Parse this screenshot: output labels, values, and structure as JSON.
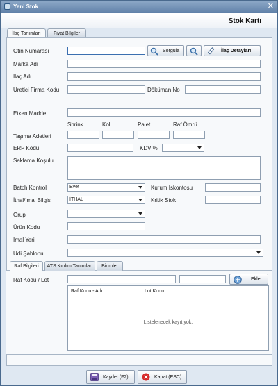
{
  "window": {
    "title": "Yeni Stok",
    "close_glyph": "✕"
  },
  "header": {
    "page_title": "Stok Kartı"
  },
  "main_tabs": [
    {
      "label": "İlaç Tanımları",
      "active": true
    },
    {
      "label": "Fiyat Bilgiler",
      "active": false
    }
  ],
  "form": {
    "gtin": {
      "label": "Gtin Numarası",
      "value": ""
    },
    "buttons": {
      "sorgula": "Sorgula",
      "ilac_detaylari": "İlaç Detayları",
      "sorgula_icon": "magnifier-icon",
      "search_icon": "magnifier-icon",
      "detail_icon": "pencil-icon"
    },
    "marka_adi": {
      "label": "Marka Adı",
      "value": ""
    },
    "ilac_adi": {
      "label": "İlaç Adı",
      "value": ""
    },
    "uretici": {
      "label": "Üretici Firma Kodu",
      "value": ""
    },
    "dokuman_no": {
      "label": "Döküman No",
      "value": ""
    },
    "etken_madde": {
      "label": "Etken Madde",
      "value": ""
    },
    "tasima": {
      "label": "Taşıma Adetleri",
      "columns": [
        "Shrink",
        "Koli",
        "Palet",
        "Raf Ömrü"
      ]
    },
    "erp_kodu": {
      "label": "ERP Kodu",
      "value": ""
    },
    "kdv": {
      "label": "KDV %",
      "value": ""
    },
    "saklama": {
      "label": "Saklama Koşulu",
      "value": ""
    },
    "batch_kontrol": {
      "label": "Batch Kontrol",
      "value": "Evet"
    },
    "kurum_iskontosu": {
      "label": "Kurum İskontosu",
      "value": ""
    },
    "ithal_imal": {
      "label": "İthal/İmal Bilgisi",
      "value": "İTHAL"
    },
    "kritik_stok": {
      "label": "Kritik Stok",
      "value": ""
    },
    "grup": {
      "label": "Grup",
      "value": ""
    },
    "urun_kodu": {
      "label": "Ürün Kodu",
      "value": ""
    },
    "imal_yeri": {
      "label": "İmal Yeri",
      "value": ""
    },
    "udi_sablonu": {
      "label": "Udi Şablonu",
      "value": ""
    }
  },
  "inner_tabs": [
    {
      "label": "Raf Bilgileri",
      "active": true
    },
    {
      "label": "ATS Kırılım Tanımları",
      "active": false
    },
    {
      "label": "Birimler",
      "active": false
    }
  ],
  "raf": {
    "label": "Raf Kodu / Lot",
    "add_button": "Ekle",
    "add_icon": "plus-circle-icon",
    "grid_columns": [
      "Raf Kodu - Adı",
      "Lot Kodu"
    ],
    "empty_text": "Listelenecek kayıt yok."
  },
  "footer": {
    "save_label": "Kaydet (F2)",
    "save_icon": "floppy-disk-icon",
    "close_label": "Kapat (ESC)",
    "close_icon": "close-circle-icon"
  },
  "colors": {
    "titlebar": "#5f80a8",
    "background": "#dfe8f2",
    "panel": "#f7f9fb",
    "close_red": "#d62b2b"
  }
}
